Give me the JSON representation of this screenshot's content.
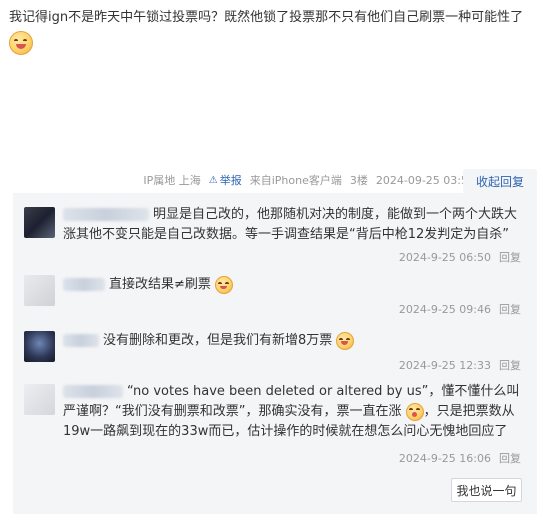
{
  "post": {
    "text": "我记得ign不是昨天中午锁过投票吗？既然他锁了投票那不只有他们自己刷票一种可能性了",
    "emoji": "laughing-face-icon"
  },
  "meta": {
    "ip": "IP属地 上海",
    "report": "举报",
    "device": "来自iPhone客户端",
    "floor": "3楼",
    "time": "2024-09-25 03:57",
    "collapse": "收起回复"
  },
  "replies": [
    {
      "text": "明显是自己改的，他那随机对决的制度，能做到一个两个大跌大涨其他不变只能是自己改数据。等一手调查结果是“背后中枪12发判定为自杀”",
      "time": "2024-9-25 06:50",
      "action": "回复"
    },
    {
      "text": "直接改结果≠刷票",
      "time": "2024-9-25 09:46",
      "action": "回复"
    },
    {
      "text": "没有删除和更改，但是我们有新增8万票",
      "time": "2024-9-25 12:33",
      "action": "回复"
    },
    {
      "text_part1": "“no votes have been deleted or altered by us”，懂不懂什么叫严谨啊？“我们没有删票和改票”，那确实没有，票一直在涨",
      "text_part2": "，只是把票数从19w一路飙到现在的33w而已，估计操作的时候就在想怎么问心无愧地回应了",
      "time": "2024-9-25 16:06",
      "action": "回复"
    }
  ],
  "speak_button": "我也说一句",
  "colors": {
    "link": "#2d64b3",
    "muted": "#999999",
    "reply_bg": "#f4f5f7"
  }
}
